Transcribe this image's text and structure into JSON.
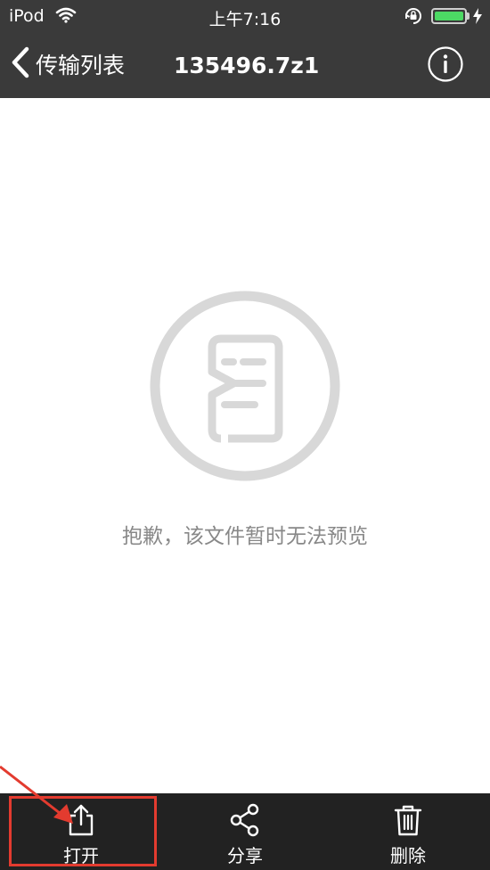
{
  "status_bar": {
    "carrier": "iPod",
    "time": "上午7:16"
  },
  "nav": {
    "back_label": "传输列表",
    "title": "135496.7z1"
  },
  "content": {
    "message": "抱歉，该文件暂时无法预览"
  },
  "toolbar": {
    "open_label": "打开",
    "share_label": "分享",
    "delete_label": "删除"
  },
  "colors": {
    "nav_bg": "#3a3a3a",
    "toolbar_bg": "#222222",
    "highlight": "#e33b2f",
    "battery": "#4cd964",
    "placeholder_icon": "#d8d8d8",
    "message_text": "#888888"
  },
  "icons": {
    "wifi": "wifi-icon",
    "lock": "rotation-lock-icon",
    "battery": "battery-icon",
    "charging": "bolt-icon",
    "back": "chevron-left-icon",
    "info": "info-icon",
    "placeholder": "file-unavailable-icon",
    "open": "share-out-icon",
    "share": "share-icon",
    "delete": "trash-icon"
  },
  "status_indicators": {
    "battery_level_fraction": 1.0
  }
}
